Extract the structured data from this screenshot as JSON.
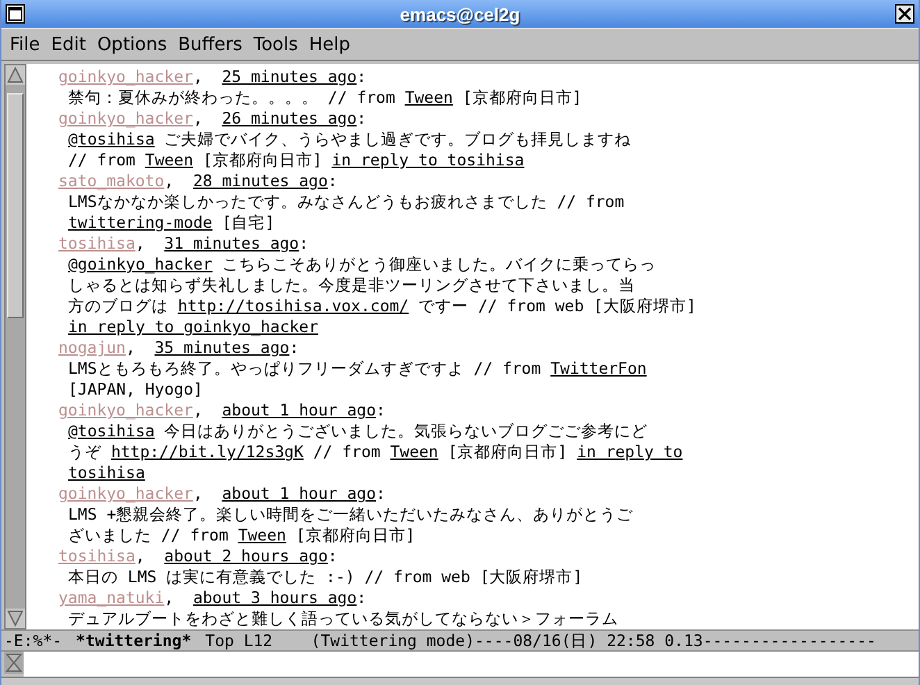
{
  "window": {
    "title": "emacs@cel2g"
  },
  "menu": [
    "File",
    "Edit",
    "Options",
    "Buffers",
    "Tools",
    "Help"
  ],
  "lines": [
    {
      "kind": "header",
      "user": "goinkyo_hacker",
      "separator": ",",
      "time": "25 minutes ago",
      "colon": ":"
    },
    {
      "kind": "body",
      "parts": [
        {
          "kind": "text",
          "text": "禁句：夏休みが終わった。。。。 // from "
        },
        {
          "kind": "link",
          "text": "Tween"
        },
        {
          "kind": "text",
          "text": " [京都府向日市]"
        }
      ]
    },
    {
      "kind": "header",
      "user": "goinkyo_hacker",
      "separator": ",",
      "time": "26 minutes ago",
      "colon": ":"
    },
    {
      "kind": "body",
      "parts": [
        {
          "kind": "link",
          "text": "@tosihisa"
        },
        {
          "kind": "text",
          "text": " ご夫婦でバイク、うらやまし過ぎです。ブログも拝見しますね"
        }
      ]
    },
    {
      "kind": "body",
      "parts": [
        {
          "kind": "text",
          "text": "// from "
        },
        {
          "kind": "link",
          "text": "Tween"
        },
        {
          "kind": "text",
          "text": " [京都府向日市] "
        },
        {
          "kind": "link",
          "text": "in reply to tosihisa"
        }
      ]
    },
    {
      "kind": "header",
      "user": "sato_makoto",
      "separator": ",",
      "time": "28 minutes ago",
      "colon": ":"
    },
    {
      "kind": "body",
      "parts": [
        {
          "kind": "text",
          "text": "LMSなかなか楽しかったです。みなさんどうもお疲れさまでした // from"
        }
      ]
    },
    {
      "kind": "body",
      "parts": [
        {
          "kind": "link",
          "text": "twittering-mode"
        },
        {
          "kind": "text",
          "text": " [自宅]"
        }
      ]
    },
    {
      "kind": "header",
      "user": "tosihisa",
      "separator": ",",
      "time": "31 minutes ago",
      "colon": ":"
    },
    {
      "kind": "body",
      "parts": [
        {
          "kind": "link",
          "text": "@goinkyo_hacker"
        },
        {
          "kind": "text",
          "text": " こちらこそありがとう御座いました。バイクに乗ってらっ"
        }
      ]
    },
    {
      "kind": "body",
      "parts": [
        {
          "kind": "text",
          "text": "しゃるとは知らず失礼しました。今度是非ツーリングさせて下さいまし。当"
        }
      ]
    },
    {
      "kind": "body",
      "parts": [
        {
          "kind": "text",
          "text": "方のブログは "
        },
        {
          "kind": "link",
          "text": "http://tosihisa.vox.com/"
        },
        {
          "kind": "text",
          "text": " ですー // from web [大阪府堺市]"
        }
      ]
    },
    {
      "kind": "body",
      "parts": [
        {
          "kind": "link",
          "text": "in reply to goinkyo_hacker"
        }
      ]
    },
    {
      "kind": "header",
      "user": "nogajun",
      "separator": ",",
      "time": "35 minutes ago",
      "colon": ":"
    },
    {
      "kind": "body",
      "parts": [
        {
          "kind": "text",
          "text": "LMSともろもろ終了。やっぱりフリーダムすぎですよ // from "
        },
        {
          "kind": "link",
          "text": "TwitterFon"
        }
      ]
    },
    {
      "kind": "body",
      "parts": [
        {
          "kind": "text",
          "text": "[JAPAN, Hyogo]"
        }
      ]
    },
    {
      "kind": "header",
      "user": "goinkyo_hacker",
      "separator": ",",
      "time": "about 1 hour ago",
      "colon": ":"
    },
    {
      "kind": "body",
      "parts": [
        {
          "kind": "link",
          "text": "@tosihisa"
        },
        {
          "kind": "text",
          "text": " 今日はありがとうございました。気張らないブログごご参考にど"
        }
      ]
    },
    {
      "kind": "body",
      "parts": [
        {
          "kind": "text",
          "text": "うぞ "
        },
        {
          "kind": "link",
          "text": "http://bit.ly/12s3gK"
        },
        {
          "kind": "text",
          "text": " // from "
        },
        {
          "kind": "link",
          "text": "Tween"
        },
        {
          "kind": "text",
          "text": " [京都府向日市] "
        },
        {
          "kind": "link",
          "text": "in reply to"
        }
      ]
    },
    {
      "kind": "body",
      "parts": [
        {
          "kind": "link",
          "text": "tosihisa"
        }
      ]
    },
    {
      "kind": "header",
      "user": "goinkyo_hacker",
      "separator": ",",
      "time": "about 1 hour ago",
      "colon": ":"
    },
    {
      "kind": "body",
      "parts": [
        {
          "kind": "text",
          "text": "LMS +懇親会終了。楽しい時間をご一緒いただいたみなさん、ありがとうご"
        }
      ]
    },
    {
      "kind": "body",
      "parts": [
        {
          "kind": "text",
          "text": "ざいました // from "
        },
        {
          "kind": "link",
          "text": "Tween"
        },
        {
          "kind": "text",
          "text": " [京都府向日市]"
        }
      ]
    },
    {
      "kind": "header",
      "user": "tosihisa",
      "separator": ",",
      "time": "about 2 hours ago",
      "colon": ":"
    },
    {
      "kind": "body",
      "parts": [
        {
          "kind": "text",
          "text": "本日の LMS は実に有意義でした :-) // from web [大阪府堺市]"
        }
      ]
    },
    {
      "kind": "header",
      "user": "yama_natuki",
      "separator": ",",
      "time": "about 3 hours ago",
      "colon": ":"
    },
    {
      "kind": "body",
      "parts": [
        {
          "kind": "text",
          "text": "デュアルブートをわざと難しく語っている気がしてならない＞フォーラム"
        }
      ]
    }
  ],
  "mode_line": {
    "status": "-E:%*-",
    "buffer": "*twittering*",
    "info": "Top L12    (Twittering mode)----08/16(日) 22:58 0.13------------------"
  }
}
